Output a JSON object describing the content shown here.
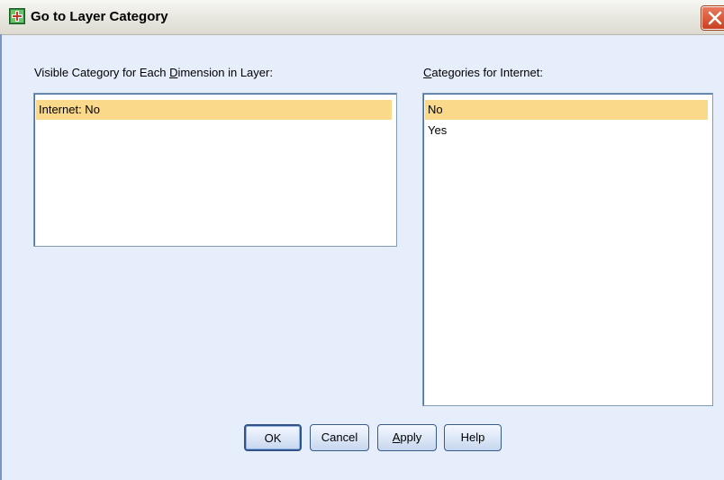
{
  "window": {
    "title": "Go to Layer Category",
    "close_icon": "close-icon",
    "app_icon": "spss-dialog-icon"
  },
  "left_panel": {
    "label_pre": "Visible Category for Each ",
    "label_mnemonic": "D",
    "label_post": "imension in Layer:",
    "items": [
      {
        "text": "Internet: No",
        "selected": true
      }
    ]
  },
  "right_panel": {
    "label_mnemonic": "C",
    "label_post": "ategories for  Internet:",
    "items": [
      {
        "text": "No",
        "selected": true
      },
      {
        "text": "Yes",
        "selected": false
      }
    ]
  },
  "buttons": {
    "ok": "OK",
    "cancel": "Cancel",
    "apply_mnemonic": "A",
    "apply_rest": "pply",
    "help": "Help"
  },
  "colors": {
    "background": "#e6eefb",
    "selection": "#fbd98a",
    "close_button": "#d6502e"
  }
}
